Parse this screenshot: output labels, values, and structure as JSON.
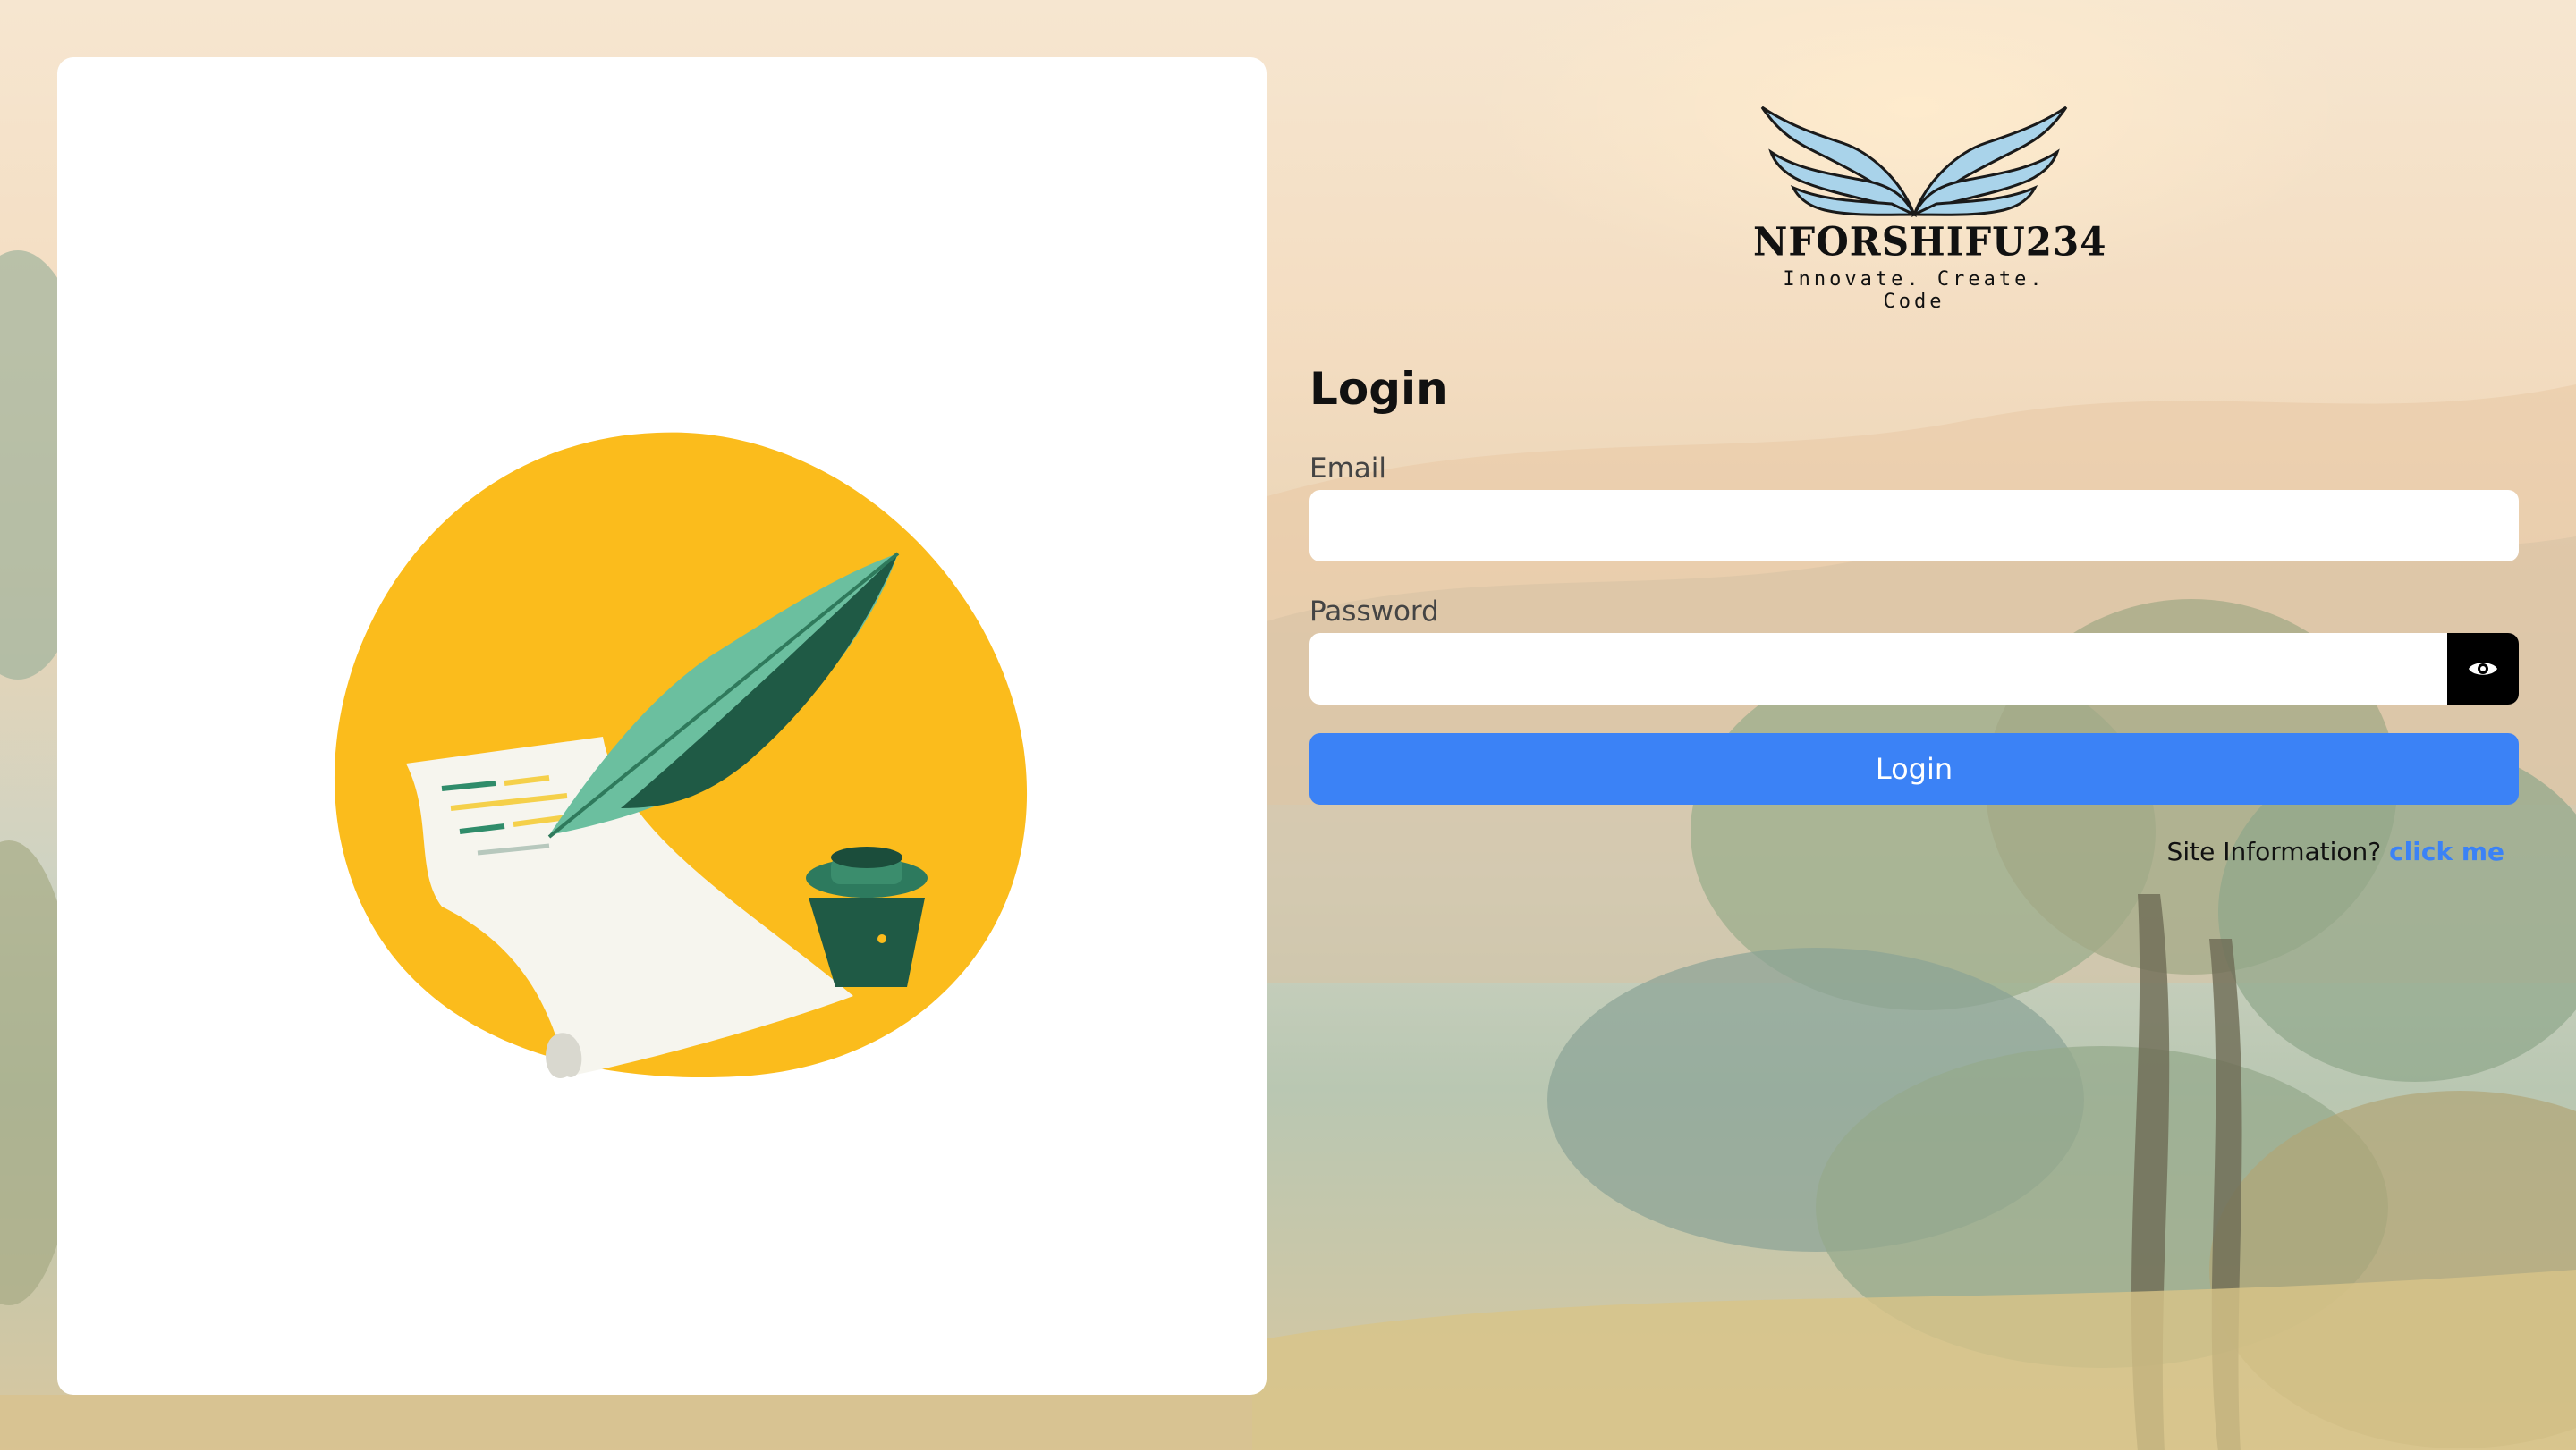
{
  "brand": {
    "name": "NFORSHIFU234",
    "tagline": "Innovate. Create. Code"
  },
  "form": {
    "title": "Login",
    "email_label": "Email",
    "email_value": "",
    "password_label": "Password",
    "password_value": "",
    "submit_label": "Login",
    "site_info_text": "Site Information?",
    "site_info_link": "click me"
  },
  "icons": {
    "password_toggle": "eye-icon",
    "logo": "wings-icon",
    "illustration": "quill-scroll-inkwell-illustration"
  },
  "colors": {
    "primary": "#3b82f6",
    "illustration_circle": "#fbbc1c",
    "feather": "#6bbf9f",
    "ink": "#1f5a45",
    "eye_button": "#000000"
  }
}
